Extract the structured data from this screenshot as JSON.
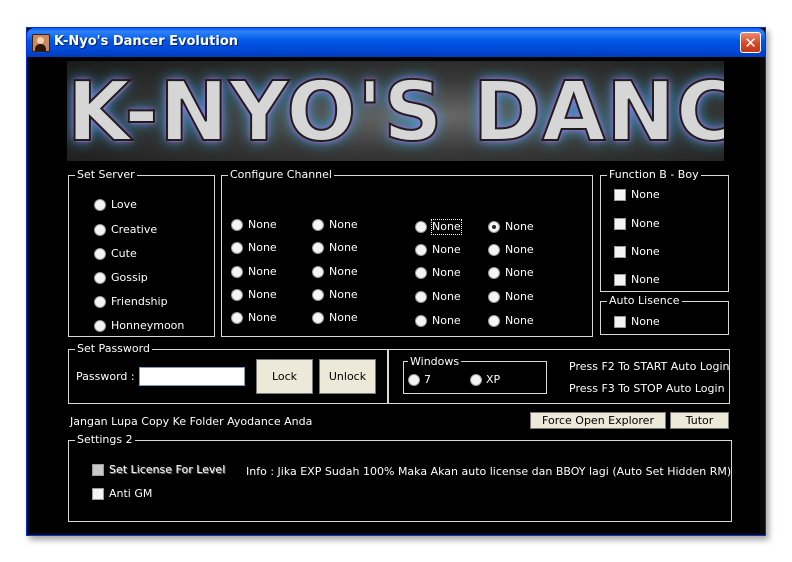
{
  "window": {
    "title": "K-Nyo's Dancer Evolution",
    "close_glyph": "✕"
  },
  "banner": {
    "text": "K-NYO'S DANCER"
  },
  "set_server": {
    "legend": "Set Server",
    "options": [
      "Love",
      "Creative",
      "Cute",
      "Gossip",
      "Friendship",
      "Honneymoon"
    ]
  },
  "configure_channel": {
    "legend": "Configure Channel",
    "columns": [
      [
        "None",
        "None",
        "None",
        "None",
        "None"
      ],
      [
        "None",
        "None",
        "None",
        "None",
        "None"
      ],
      [
        "None",
        "None",
        "None",
        "None",
        "None"
      ],
      [
        "None",
        "None",
        "None",
        "None",
        "None"
      ]
    ],
    "selected": {
      "column": 3,
      "row": 1
    }
  },
  "function_bboy": {
    "legend": "Function B - Boy",
    "items": [
      "None",
      "None",
      "None",
      "None"
    ]
  },
  "auto_license": {
    "legend": "Auto Lisence",
    "item": "None"
  },
  "set_password": {
    "legend": "Set Password",
    "password_label": "Password :",
    "password_value": "",
    "lock_label": "Lock",
    "unlock_label": "Unlock"
  },
  "windows_group": {
    "legend": "Windows",
    "options": [
      "7",
      "XP"
    ]
  },
  "hotkeys": {
    "start": "Press F2 To START Auto Login",
    "stop": "Press F3 To STOP Auto Login"
  },
  "notice": "Jangan Lupa Copy Ke Folder Ayodance Anda",
  "buttons": {
    "force_open_explorer": "Force Open Explorer",
    "tutor": "Tutor"
  },
  "settings2": {
    "legend": "Settings 2",
    "set_license_label": "Set License For Level",
    "anti_gm_label": "Anti GM",
    "info": "Info :  Jika EXP Sudah 100% Maka Akan auto license dan BBOY lagi (Auto Set Hidden RM)"
  },
  "colors": {
    "titlebar": "#0054e3",
    "background": "#000000",
    "text": "#ffffff",
    "button_face": "#ece9d8",
    "close_button": "#d4482a"
  }
}
